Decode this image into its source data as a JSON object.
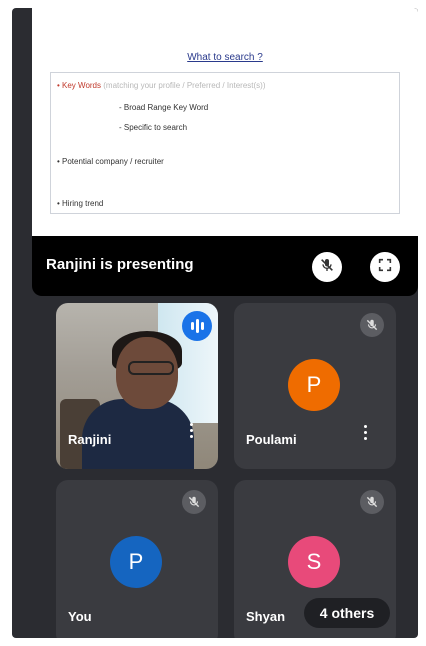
{
  "slide": {
    "title": "What to search ?",
    "bullets": [
      {
        "text": "• Key Words",
        "note": "(matching your profile / Preferred / Interest(s))"
      },
      {
        "text": "- Broad Range Key Word"
      },
      {
        "text": "- Specific to search"
      },
      {
        "text": "• Potential company / recruiter"
      },
      {
        "text": "• Hiring trend"
      }
    ]
  },
  "presentation": {
    "status": "Ranjini is presenting",
    "mic_icon": "mic-off-icon",
    "fullscreen_icon": "fullscreen-icon"
  },
  "participants": [
    {
      "name": "Ranjini",
      "initial": "",
      "speaking": true
    },
    {
      "name": "Poulami",
      "initial": "P",
      "muted": true,
      "color": "#ef6c00"
    },
    {
      "name": "You",
      "initial": "P",
      "muted": true,
      "color": "#1565c0"
    },
    {
      "name": "Shyan",
      "initial": "S",
      "muted": true,
      "color": "#e84a7a"
    }
  ],
  "others": {
    "label": "4 others"
  }
}
